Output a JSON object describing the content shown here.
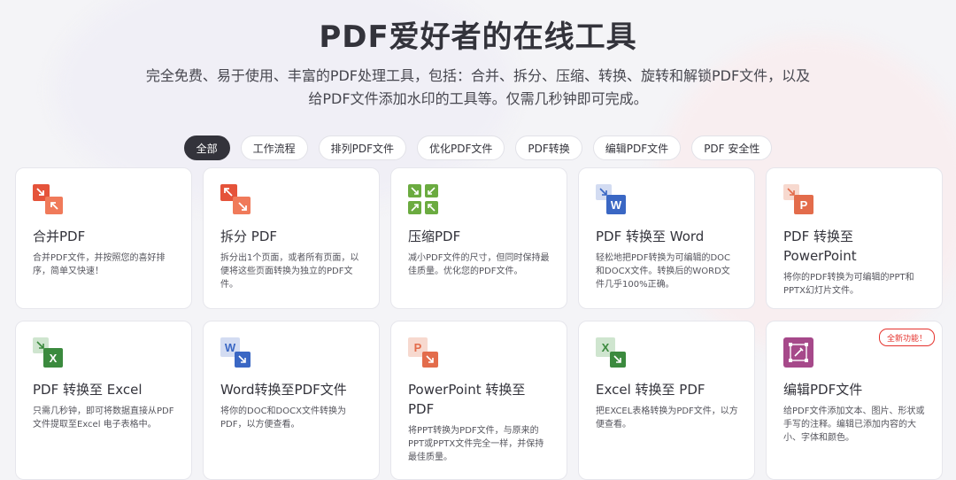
{
  "header": {
    "title": "PDF爱好者的在线工具",
    "subtitle": "完全免费、易于使用、丰富的PDF处理工具，包括：合并、拆分、压缩、转换、旋转和解锁PDF文件，以及给PDF文件添加水印的工具等。仅需几秒钟即可完成。"
  },
  "filters": [
    {
      "label": "全部",
      "active": true
    },
    {
      "label": "工作流程"
    },
    {
      "label": "排列PDF文件"
    },
    {
      "label": "优化PDF文件"
    },
    {
      "label": "PDF转换"
    },
    {
      "label": "编辑PDF文件"
    },
    {
      "label": "PDF 安全性"
    }
  ],
  "tools": [
    {
      "title": "合并PDF",
      "desc": "合并PDF文件，并按照您的喜好排序，简单又快速！",
      "icon": "merge-pdf-icon"
    },
    {
      "title": "拆分 PDF",
      "desc": "拆分出1个页面，或者所有页面，以便将这些页面转换为独立的PDF文件。",
      "icon": "split-pdf-icon"
    },
    {
      "title": "压缩PDF",
      "desc": "减小PDF文件的尺寸，但同时保持最佳质量。优化您的PDF文件。",
      "icon": "compress-pdf-icon"
    },
    {
      "title": "PDF 转换至 Word",
      "desc": "轻松地把PDF转换为可编辑的DOC和DOCX文件。转换后的WORD文件几乎100%正确。",
      "icon": "pdf-to-word-icon",
      "letter": "W"
    },
    {
      "title": "PDF 转换至 PowerPoint",
      "desc": "将你的PDF转换为可编辑的PPT和PPTX幻灯片文件。",
      "icon": "pdf-to-powerpoint-icon",
      "letter": "P"
    },
    {
      "title": "PDF 转换至 Excel",
      "desc": "只需几秒钟，即可将数据直接从PDF文件提取至Excel 电子表格中。",
      "icon": "pdf-to-excel-icon",
      "letter": "X"
    },
    {
      "title": "Word转换至PDF文件",
      "desc": "将你的DOC和DOCX文件转换为PDF，以方便查看。",
      "icon": "word-to-pdf-icon",
      "letter": "W"
    },
    {
      "title": "PowerPoint 转换至 PDF",
      "desc": "将PPT转换为PDF文件，与原来的PPT或PPTX文件完全一样，并保持最佳质量。",
      "icon": "powerpoint-to-pdf-icon",
      "letter": "P"
    },
    {
      "title": "Excel 转换至 PDF",
      "desc": "把EXCEL表格转换为PDF文件，以方便查看。",
      "icon": "excel-to-pdf-icon",
      "letter": "X"
    },
    {
      "title": "编辑PDF文件",
      "desc": "给PDF文件添加文本、图片、形状或手写的注释。编辑已添加内容的大小、字体和颜色。",
      "icon": "edit-pdf-icon",
      "badge": "全新功能！"
    }
  ],
  "colors": {
    "merge": "#e5533a",
    "compress": "#6bab40",
    "word": "#3a67c4",
    "powerpoint": "#e36c4b",
    "excel": "#3b8a3e",
    "edit": "#a6498a"
  }
}
